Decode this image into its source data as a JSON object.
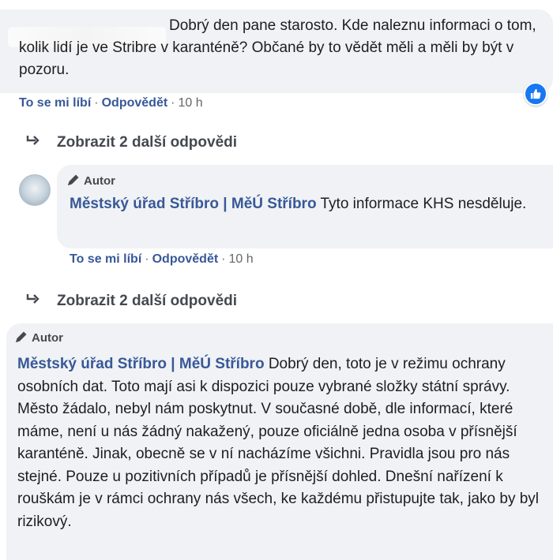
{
  "comment1": {
    "text": "Dobrý den pane starosto. Kde naleznu informaci o tom, kolik lidí je ve Stribre v karanténě? Občané by to vědět měli a měli by být v pozoru.",
    "like_label": "To se mi líbí",
    "reply_label": "Odpovědět",
    "separator": "·",
    "time": "10 h",
    "reaction_icon": "thumbs-up-icon"
  },
  "more_replies_1": {
    "label": "Zobrazit 2 další odpovědi"
  },
  "reply1": {
    "badge": "Autor",
    "author": "Městský úřad Stříbro | MěÚ Stříbro",
    "text": "Tyto informace KHS nesděluje.",
    "like_label": "To se mi líbí",
    "reply_label": "Odpovědět",
    "separator": "·",
    "time": "10 h"
  },
  "more_replies_2": {
    "label": "Zobrazit 2 další odpovědi"
  },
  "reply2": {
    "badge": "Autor",
    "author": "Městský úřad Stříbro | MěÚ Stříbro",
    "text": "Dobrý den, toto je v režimu ochrany osobních dat. Toto mají asi k dispozici pouze vybrané složky státní správy. Město žádalo, nebyl nám poskytnut. V současné době, dle informací, které máme, není u nás žádný nakažený, pouze oficiálně jedna osoba v přísnější karanténě. Jinak, obecně se v ní nacházíme všichni. Pravidla jsou pro nás stejné. Pouze u pozitivních případů je přísnější dohled. Dnešní nařízení k rouškám je v rámci ochrany nás všech, ke každému přistupujte tak, jako by byl rizikový."
  },
  "colors": {
    "bubble": "#f0f2f5",
    "link": "#385898",
    "like_badge": "#1877f2"
  }
}
